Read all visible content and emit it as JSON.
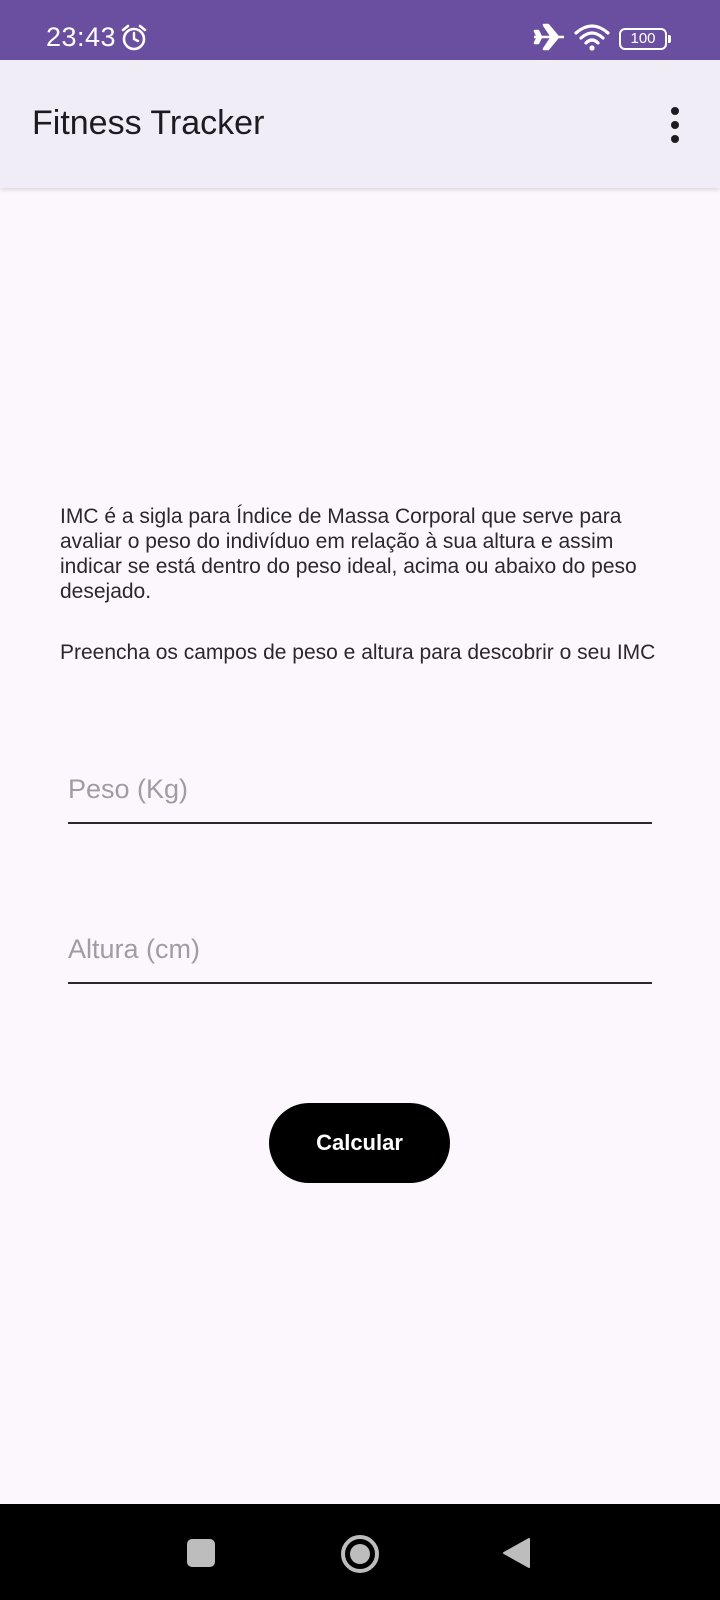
{
  "status_bar": {
    "time": "23:43",
    "battery_level": "100",
    "icons": [
      "alarm-icon",
      "airplane-icon",
      "wifi-icon",
      "battery-icon"
    ],
    "background_color": "#6A4FA1"
  },
  "app_bar": {
    "title": "Fitness Tracker",
    "menu_icon": "overflow-menu-icon",
    "background_color": "#F1EDF6"
  },
  "main": {
    "description": "IMC é a sigla para Índice de Massa Corporal que serve para avaliar o peso do indivíduo em relação à sua altura e assim indicar se está dentro do peso ideal, acima ou abaixo do peso desejado.",
    "instruction": "Preencha os campos de peso e altura para descobrir o seu IMC",
    "weight_field": {
      "placeholder": "Peso (Kg)",
      "value": ""
    },
    "height_field": {
      "placeholder": "Altura (cm)",
      "value": ""
    },
    "calculate_button_label": "Calcular",
    "background_color": "#FCF7FD"
  },
  "nav_bar": {
    "icons": [
      "nav-recents-icon",
      "nav-home-icon",
      "nav-back-icon"
    ]
  }
}
